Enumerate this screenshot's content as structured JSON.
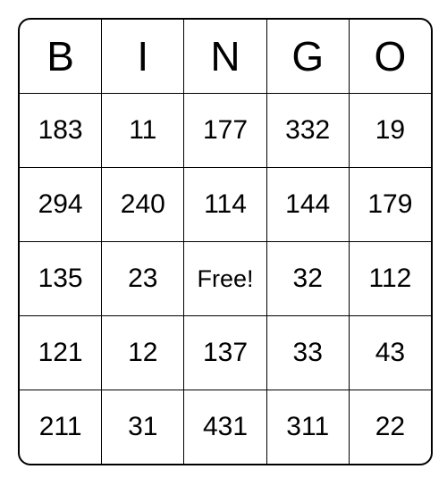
{
  "headers": [
    "B",
    "I",
    "N",
    "G",
    "O"
  ],
  "grid": [
    [
      "183",
      "11",
      "177",
      "332",
      "19"
    ],
    [
      "294",
      "240",
      "114",
      "144",
      "179"
    ],
    [
      "135",
      "23",
      "Free!",
      "32",
      "112"
    ],
    [
      "121",
      "12",
      "137",
      "33",
      "43"
    ],
    [
      "211",
      "31",
      "431",
      "311",
      "22"
    ]
  ]
}
